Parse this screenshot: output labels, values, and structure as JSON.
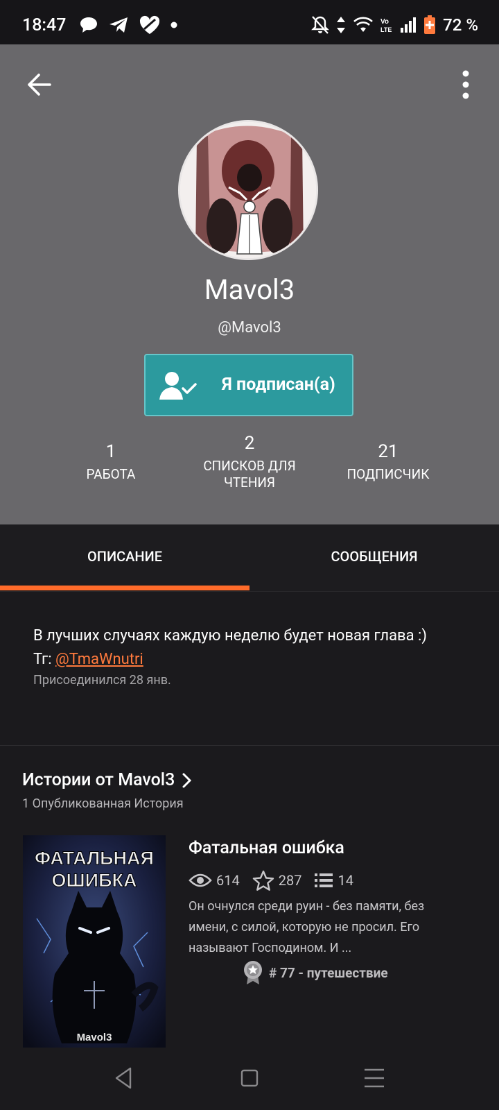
{
  "status_bar": {
    "time": "18:47",
    "battery": "72 %",
    "left_icons": [
      "chat-bubble-icon",
      "telegram-icon",
      "heart-icon",
      "dot-icon"
    ],
    "right_icons": [
      "bell-off-icon",
      "data-arrows-icon",
      "wifi-icon",
      "volte-icon",
      "signal-icon",
      "battery-icon"
    ]
  },
  "header": {
    "display_name": "Mavol3",
    "handle": "@Mavol3",
    "follow_button": "Я подписан(а)"
  },
  "stats": [
    {
      "value": "1",
      "label": "РАБОТА"
    },
    {
      "value": "2",
      "label": "СПИСКОВ ДЛЯ ЧТЕНИЯ"
    },
    {
      "value": "21",
      "label": "ПОДПИСЧИК"
    }
  ],
  "tabs": {
    "active": "ОПИСАНИЕ",
    "other": "СООБЩЕНИЯ"
  },
  "description": {
    "line1": "В лучших случаях каждую неделю будет новая глава :)",
    "tg_prefix": "Тг: ",
    "tg_link": "@TmaWnutri",
    "joined": "Присоединился 28 янв."
  },
  "stories": {
    "title": "Истории от Mavol3",
    "subtitle": "1 Опубликованная История",
    "items": [
      {
        "title": "Фатальная ошибка",
        "cover_title_line1": "ФАТАЛЬНАЯ",
        "cover_title_line2": "ОШИБКА",
        "cover_author": "Mavol3",
        "reads": "614",
        "votes": "287",
        "parts": "14",
        "description": "Он очнулся среди руин - без памяти, без имени, с силой, которую не просил. Его называют Господином. И ...",
        "rank": "# 77 - путешествие"
      }
    ]
  },
  "colors": {
    "accent": "#ff6b2a",
    "follow_button": "#2c9a9e",
    "header_bg": "#69686b",
    "page_bg": "#1b1a1d"
  }
}
